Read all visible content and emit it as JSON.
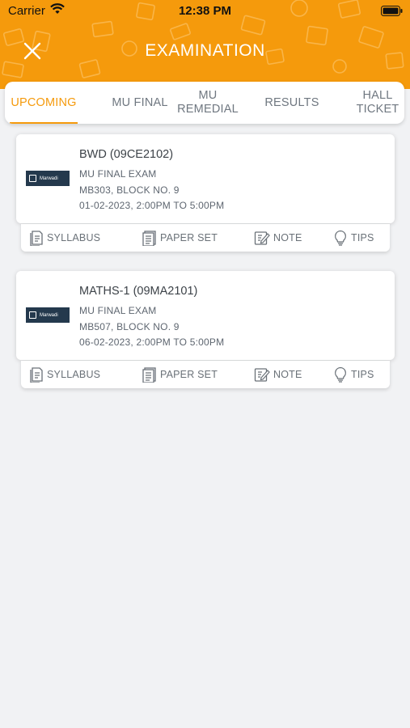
{
  "status_bar": {
    "carrier": "Carrier",
    "time": "12:38 PM"
  },
  "header": {
    "title": "EXAMINATION",
    "accent_color": "#f59a0c"
  },
  "tabs": [
    {
      "label": "UPCOMING",
      "active": true
    },
    {
      "label": "MU FINAL",
      "active": false
    },
    {
      "label": "MU\nREMEDIAL",
      "active": false
    },
    {
      "label": "RESULTS",
      "active": false
    },
    {
      "label": "HALL\nTICKET",
      "active": false
    }
  ],
  "exams": [
    {
      "subject": "BWD (09CE2102)",
      "exam_type": "MU FINAL EXAM",
      "venue": "MB303, BLOCK NO. 9",
      "schedule": "01-02-2023, 2:00PM TO 5:00PM"
    },
    {
      "subject": "MATHS-1 (09MA2101)",
      "exam_type": "MU FINAL EXAM",
      "venue": "MB507, BLOCK NO. 9",
      "schedule": "06-02-2023, 2:00PM TO 5:00PM"
    }
  ],
  "logo_text": "Marwadi",
  "actions": {
    "syllabus": "SYLLABUS",
    "paper_set": "PAPER SET",
    "note": "NOTE",
    "tips": "TIPS"
  }
}
